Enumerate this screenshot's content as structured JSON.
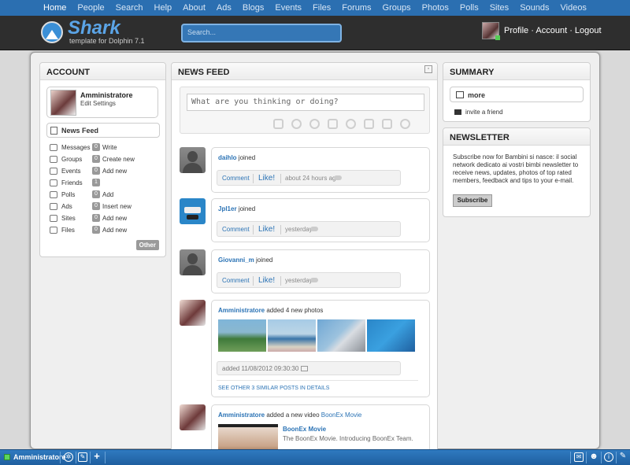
{
  "nav": {
    "items": [
      "Home",
      "People",
      "Search",
      "Help",
      "About",
      "Ads",
      "Blogs",
      "Events",
      "Files",
      "Forums",
      "Groups",
      "Photos",
      "Polls",
      "Sites",
      "Sounds",
      "Videos"
    ]
  },
  "header": {
    "logo": "Shark",
    "tagline": "template for Dolphin 7.1",
    "search_placeholder": "Search...",
    "links": {
      "profile": "Profile",
      "account": "Account",
      "logout": "Logout",
      "sep": "·"
    }
  },
  "account": {
    "title": "ACCOUNT",
    "user_name": "Amministratore",
    "edit_settings": "Edit Settings",
    "newsfeed": "News Feed",
    "items": [
      {
        "label": "Messages",
        "count": "0",
        "action": "Write"
      },
      {
        "label": "Groups",
        "count": "0",
        "action": "Create new"
      },
      {
        "label": "Events",
        "count": "0",
        "action": "Add new"
      },
      {
        "label": "Friends",
        "count": "1",
        "action": ""
      },
      {
        "label": "Polls",
        "count": "0",
        "action": "Add"
      },
      {
        "label": "Ads",
        "count": "0",
        "action": "Insert new"
      },
      {
        "label": "Sites",
        "count": "0",
        "action": "Add new"
      },
      {
        "label": "Files",
        "count": "0",
        "action": "Add new"
      }
    ],
    "other": "Other"
  },
  "feed": {
    "title": "NEWS FEED",
    "compose_placeholder": "What are you thinking or doing?",
    "comment": "Comment",
    "like": "Like!",
    "posts": [
      {
        "user": "daihlo",
        "text": "joined",
        "time": "about 24 hours ago"
      },
      {
        "user": "Jpl1er",
        "text": "joined",
        "time": "yesterday"
      },
      {
        "user": "Giovanni_m",
        "text": "joined",
        "time": "yesterday"
      }
    ],
    "photos_post": {
      "user": "Amministratore",
      "text": "added 4 new photos",
      "added": "added 11/08/2012 09:30:30",
      "similar": "SEE OTHER 3 SIMILAR POSTS IN DETAILS"
    },
    "video_post": {
      "user": "Amministratore",
      "text": "added a new video",
      "link": "BoonEx Movie",
      "video_title": "BoonEx Movie",
      "video_desc": "The BoonEx Movie. Introducing BoonEx Team."
    }
  },
  "summary": {
    "title": "SUMMARY",
    "more": "more",
    "invite": "invite a friend"
  },
  "newsletter": {
    "title": "NEWSLETTER",
    "text": "Subscribe now for Bambini si nasce: il social network dedicato ai vostri bimbi newsletter to receive news, updates, photos of top rated members, feedback and tips to your e-mail.",
    "button": "Subscribe"
  },
  "bottombar": {
    "user": "Amministratore"
  }
}
